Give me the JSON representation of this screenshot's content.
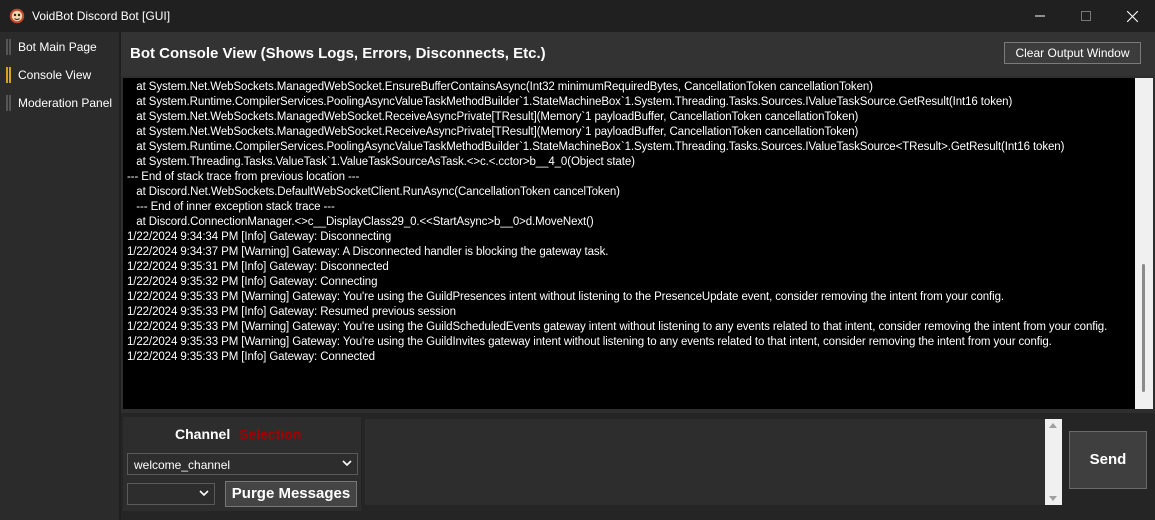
{
  "window": {
    "title": "VoidBot Discord Bot [GUI]",
    "app_icon": "voidbot-logo-icon",
    "controls": [
      "minimize-icon",
      "maximize-icon",
      "close-icon"
    ]
  },
  "sidebar": {
    "items": [
      {
        "label": "Bot Main Page",
        "active": false
      },
      {
        "label": "Console View",
        "active": true
      },
      {
        "label": "Moderation Panel",
        "active": false
      }
    ],
    "accent_color": "#d7a21b"
  },
  "console": {
    "title": "Bot Console View (Shows Logs, Errors, Disconnects, Etc.)",
    "clear_label": "Clear Output Window",
    "lines": [
      "   at System.Net.WebSockets.ManagedWebSocket.EnsureBufferContainsAsync(Int32 minimumRequiredBytes, CancellationToken cancellationToken)",
      "   at System.Runtime.CompilerServices.PoolingAsyncValueTaskMethodBuilder`1.StateMachineBox`1.System.Threading.Tasks.Sources.IValueTaskSource.GetResult(Int16 token)",
      "   at System.Net.WebSockets.ManagedWebSocket.ReceiveAsyncPrivate[TResult](Memory`1 payloadBuffer, CancellationToken cancellationToken)",
      "   at System.Net.WebSockets.ManagedWebSocket.ReceiveAsyncPrivate[TResult](Memory`1 payloadBuffer, CancellationToken cancellationToken)",
      "   at System.Runtime.CompilerServices.PoolingAsyncValueTaskMethodBuilder`1.StateMachineBox`1.System.Threading.Tasks.Sources.IValueTaskSource<TResult>.GetResult(Int16 token)",
      "   at System.Threading.Tasks.ValueTask`1.ValueTaskSourceAsTask.<>c.<.cctor>b__4_0(Object state)",
      "--- End of stack trace from previous location ---",
      "   at Discord.Net.WebSockets.DefaultWebSocketClient.RunAsync(CancellationToken cancelToken)",
      "   --- End of inner exception stack trace ---",
      "   at Discord.ConnectionManager.<>c__DisplayClass29_0.<<StartAsync>b__0>d.MoveNext()",
      "1/22/2024 9:34:34 PM [Info] Gateway: Disconnecting",
      "1/22/2024 9:34:37 PM [Warning] Gateway: A Disconnected handler is blocking the gateway task.",
      "1/22/2024 9:35:31 PM [Info] Gateway: Disconnected",
      "1/22/2024 9:35:32 PM [Info] Gateway: Connecting",
      "1/22/2024 9:35:33 PM [Warning] Gateway: You're using the GuildPresences intent without listening to the PresenceUpdate event, consider removing the intent from your config.",
      "1/22/2024 9:35:33 PM [Info] Gateway: Resumed previous session",
      "1/22/2024 9:35:33 PM [Warning] Gateway: You're using the GuildScheduledEvents gateway intent without listening to any events related to that intent, consider removing the intent from your config.",
      "1/22/2024 9:35:33 PM [Warning] Gateway: You're using the GuildInvites gateway intent without listening to any events related to that intent, consider removing the intent from your config.",
      "1/22/2024 9:35:33 PM [Info] Gateway: Connected"
    ]
  },
  "channel": {
    "label": "Channel",
    "selection_label": "Selection",
    "selection_color": "#a30000",
    "selected": "welcome_channel",
    "secondary_selected": "",
    "purge_label": "Purge Messages"
  },
  "message": {
    "value": "",
    "send_label": "Send"
  }
}
